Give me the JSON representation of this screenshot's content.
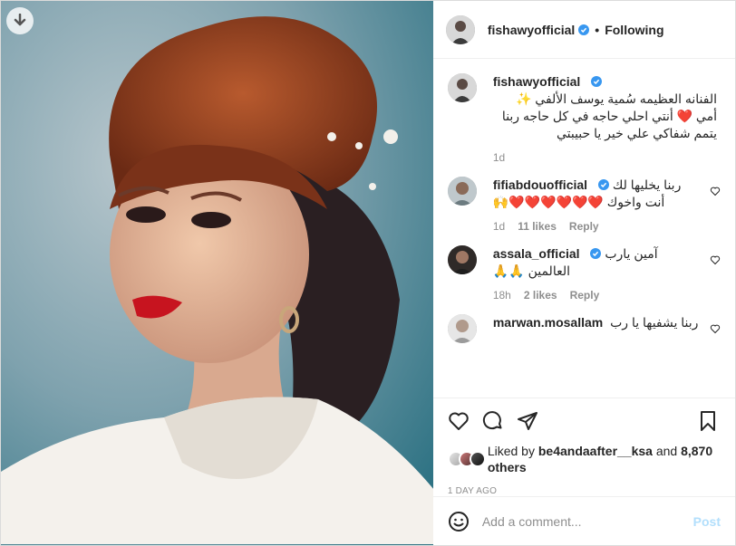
{
  "header": {
    "username": "fishawyofficial",
    "separator": "•",
    "follow_status": "Following"
  },
  "caption": {
    "username": "fishawyofficial",
    "text": "الفنانه العظيمه سُمية يوسف الألفي ✨ أمي ❤️ أنتي احلي حاجه في كل حاجه ربنا يتمم شفاكي علي خير يا حبيبتي",
    "time": "1d"
  },
  "comments": [
    {
      "username": "fifiabdouofficial",
      "text": "ربنا يخليها لك أنت واخوك ❤️❤️❤️❤️❤️❤️🙌",
      "time": "1d",
      "likes": "11 likes",
      "reply": "Reply"
    },
    {
      "username": "assala_official",
      "text": "آمين يارب العالمين 🙏🙏",
      "time": "18h",
      "likes": "2 likes",
      "reply": "Reply"
    },
    {
      "username": "marwan.mosallam",
      "text": "ربنا يشفيها يا رب",
      "time": "",
      "likes": "",
      "reply": ""
    }
  ],
  "likes": {
    "prefix": "Liked by ",
    "user": "be4andaafter__ksa",
    "middle": " and ",
    "count": "8,870 others"
  },
  "timestamp": "1 DAY AGO",
  "add_comment": {
    "placeholder": "Add a comment...",
    "post_label": "Post"
  },
  "icons": {
    "download": "download-icon",
    "verified": "verified-badge-icon",
    "heart": "heart-icon",
    "comment": "comment-icon",
    "share": "share-icon",
    "save": "bookmark-icon",
    "emoji": "emoji-icon"
  },
  "colors": {
    "verified": "#3897f0",
    "post_button": "#b2dffc",
    "muted": "#8e8e8e"
  }
}
